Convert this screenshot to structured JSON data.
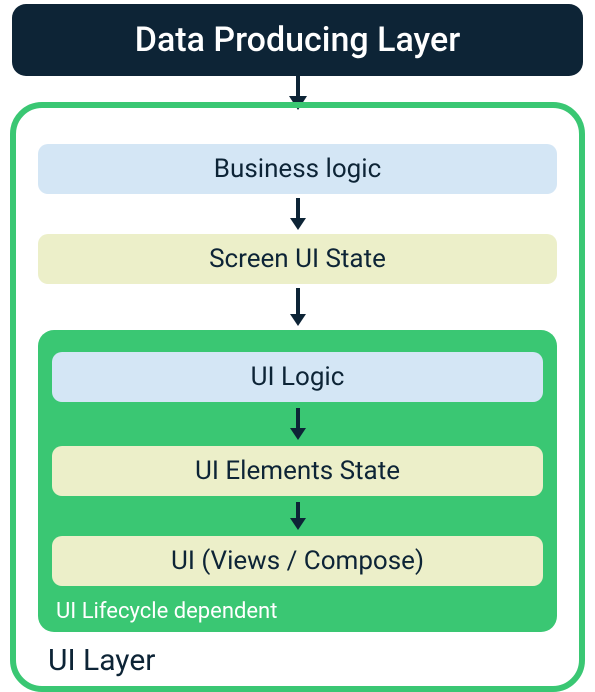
{
  "header": {
    "title": "Data Producing Layer"
  },
  "ui_layer": {
    "label": "UI Layer",
    "business_logic": "Business logic",
    "screen_ui_state": "Screen UI State",
    "lifecycle": {
      "label": "UI Lifecycle dependent",
      "ui_logic": "UI Logic",
      "ui_elements_state": "UI Elements State",
      "ui_views": "UI (Views / Compose)"
    }
  },
  "colors": {
    "header_bg": "#0d2436",
    "green": "#3ac773",
    "blue_box": "#d4e6f5",
    "yellow_box": "#ecefc9"
  }
}
